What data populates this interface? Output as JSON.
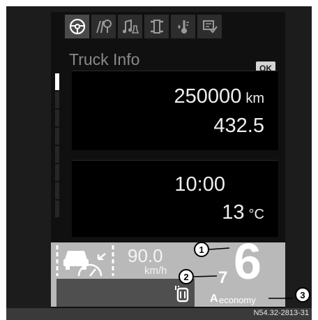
{
  "tabs": [
    {
      "icon": "steering-wheel-icon",
      "active": true
    },
    {
      "icon": "road-sign-icon",
      "active": false
    },
    {
      "icon": "audio-icon",
      "active": false
    },
    {
      "icon": "vehicle-status-icon",
      "active": false
    },
    {
      "icon": "temperature-icon",
      "active": false
    },
    {
      "icon": "settings-icon",
      "active": false
    }
  ],
  "menu": {
    "title": "Truck Info",
    "ok_label": "OK"
  },
  "box1": {
    "odometer_value": "250000",
    "odometer_unit": "km",
    "trip_value": "432.5"
  },
  "box2": {
    "time": "10:00",
    "temperature_value": "13",
    "temperature_unit": "°C"
  },
  "drive": {
    "cruise_speed": "90.0",
    "cruise_unit": "km/h",
    "current_gear": "6",
    "recommended_gear": "7",
    "mode_letter": "A",
    "mode_label": "economy"
  },
  "callouts": [
    "1",
    "2",
    "3"
  ],
  "reference": "N54.32-2813-31",
  "colors": {
    "screen_bg": "#101010",
    "panel_grey": "#b9b9b9",
    "text": "#eeeeee"
  }
}
